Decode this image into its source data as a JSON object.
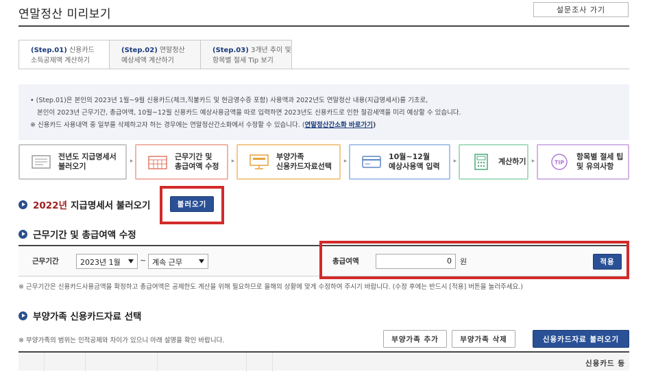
{
  "page": {
    "title": "연말정산 미리보기",
    "survey_button": "설문조사 가기"
  },
  "tabs": [
    {
      "step": "(Step.01)",
      "line1": " 신용카드",
      "line2": "소득공제액 계산하기",
      "active": true
    },
    {
      "step": "(Step.02)",
      "line1": " 연말정산",
      "line2": "예상세액 계산하기",
      "active": false
    },
    {
      "step": "(Step.03)",
      "line1": " 3개년 추이 및",
      "line2": "항목별 절세 Tip 보기",
      "active": false
    }
  ],
  "info": {
    "line1": "• (Step.01)은 본인의 2023년 1월~9월 신용카드(체크,직불카드 및 현금영수증 포함) 사용액과 2022년도 연말정산 내용(지급명세서)를 기초로,",
    "line2": "본인이 2023년 근무기간, 총급여액, 10월~12월 신용카드 예상사용금액을 따로 입력하면 2023년도 신용카드로 인한 절감세액을 미리 예상할 수 있습니다.",
    "line3_prefix": "※ 신용카드 사용내역 중 일부를 삭제하고자 하는 경우에는 연말정산간소화에서 수정할 수 있습니다. (",
    "line3_link": "연말정산간소화 바로가기",
    "line3_suffix": ")"
  },
  "steps": [
    {
      "line1": "전년도 지급명세서",
      "line2": "불러오기",
      "color": "#c8c8c8",
      "icon": "document-icon"
    },
    {
      "line1": "근무기간 및",
      "line2": "총급여액 수정",
      "color": "#f0b4a8",
      "icon": "calendar-icon"
    },
    {
      "line1": "부양가족",
      "line2": "신용카드자료선택",
      "color": "#f2c98c",
      "icon": "monitor-icon"
    },
    {
      "line1": "10월~12월",
      "line2": "예상사용액 입력",
      "color": "#a9c4e8",
      "icon": "card-icon"
    },
    {
      "line1": "계산하기",
      "line2": "",
      "color": "#a8dcc0",
      "icon": "calculator-icon"
    },
    {
      "line1": "항목별 절세 팁",
      "line2": "및 유의사항",
      "color": "#d2b6e4",
      "icon": "tip-icon"
    }
  ],
  "section1": {
    "year": "2022년",
    "title": "지급명세서 불러오기",
    "button": "불러오기"
  },
  "section2": {
    "title": "근무기간 및 총급여액 수정",
    "period_label": "근무기간",
    "start_value": "2023년 1월",
    "separator": "~",
    "end_value": "계속 근무",
    "salary_label": "총급여액",
    "salary_value": "0",
    "unit": "원",
    "apply_button": "적용",
    "note": "※ 근무기간은 신용카드사용금액을 확정하고 총급여액은 공제한도 계산을 위해 필요하므로 올해의 상황에 맞게 수정하여 주시기 바랍니다. (수정 후에는 반드시 [적용] 버튼을 눌러주세요.)"
  },
  "section3": {
    "title": "부양가족 신용카드자료 선택",
    "note": "※ 부양가족의 범위는 인적공제와 차이가 있으니 아래 설명을 확인 바랍니다.",
    "add_button": "부양가족 추가",
    "delete_button": "부양가족 삭제",
    "load_button": "신용카드자료 불러오기",
    "table_header_card": "신용카드 등"
  },
  "colors": {
    "navy": "#2a5196",
    "highlight_red": "#d22a2a"
  }
}
